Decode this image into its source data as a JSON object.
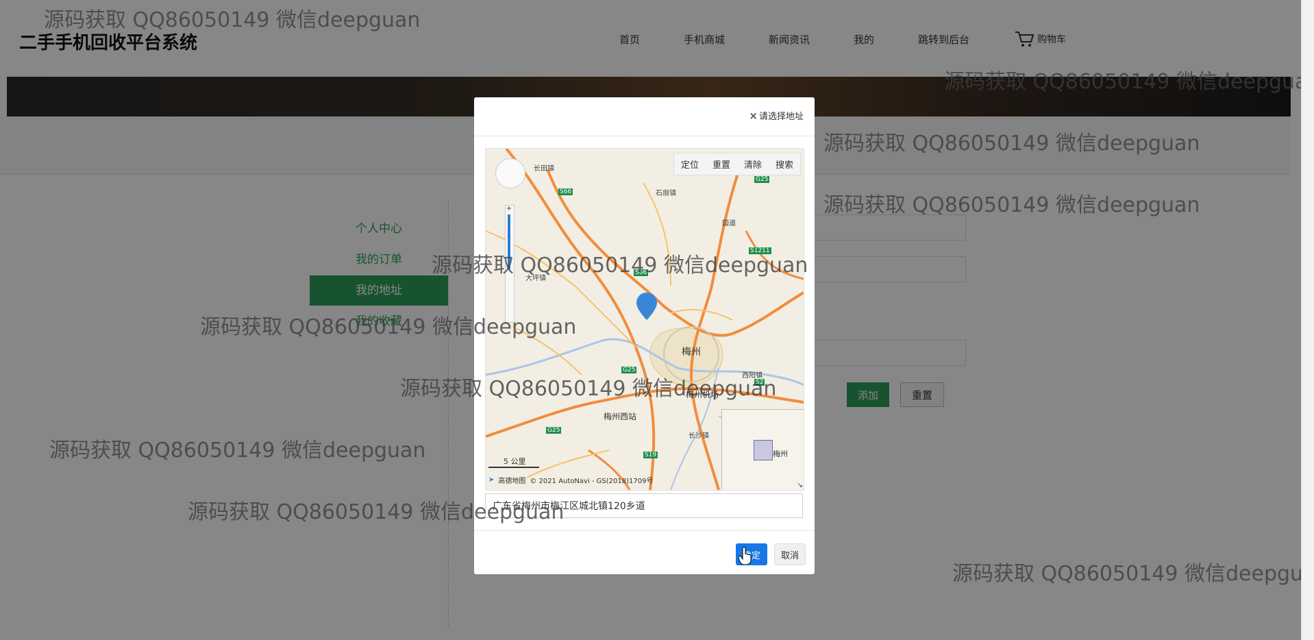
{
  "header": {
    "site_title": "二手手机回收平台系统",
    "nav": [
      "首页",
      "手机商城",
      "新闻资讯",
      "我的",
      "跳转到后台"
    ],
    "cart_label": "购物车"
  },
  "sidebar": {
    "items": [
      {
        "label": "个人中心"
      },
      {
        "label": "我的订单"
      },
      {
        "label": "我的地址"
      },
      {
        "label": "我的收藏"
      }
    ]
  },
  "form": {
    "add_label": "添加",
    "reset_label": "重置"
  },
  "modal": {
    "title": "请选择地址",
    "close_icon": "close-icon",
    "toolbar": [
      "定位",
      "重置",
      "清除",
      "搜索"
    ],
    "address_value": "广东省梅州市梅江区城北镇120乡道",
    "confirm_label": "确定",
    "cancel_label": "取消",
    "map": {
      "labels": [
        "长田镇",
        "石扇镇",
        "国道",
        "大坪镇",
        "梅州",
        "西阳镇",
        "梅州西站",
        "梅州机场",
        "长沙镇",
        "梅州"
      ],
      "road_badges": [
        "G25",
        "S66",
        "S1211",
        "S66",
        "G25",
        "G25",
        "S19",
        "S2"
      ],
      "scale_label": "5 公里",
      "provider": "高德地图",
      "copyright": "© 2021 AutoNavi - GS(2018)1709号"
    }
  },
  "watermark": "源码获取 QQ86050149 微信deepguan",
  "colors": {
    "accent_green": "#2e9e5a",
    "confirm_blue": "#1677e5"
  }
}
